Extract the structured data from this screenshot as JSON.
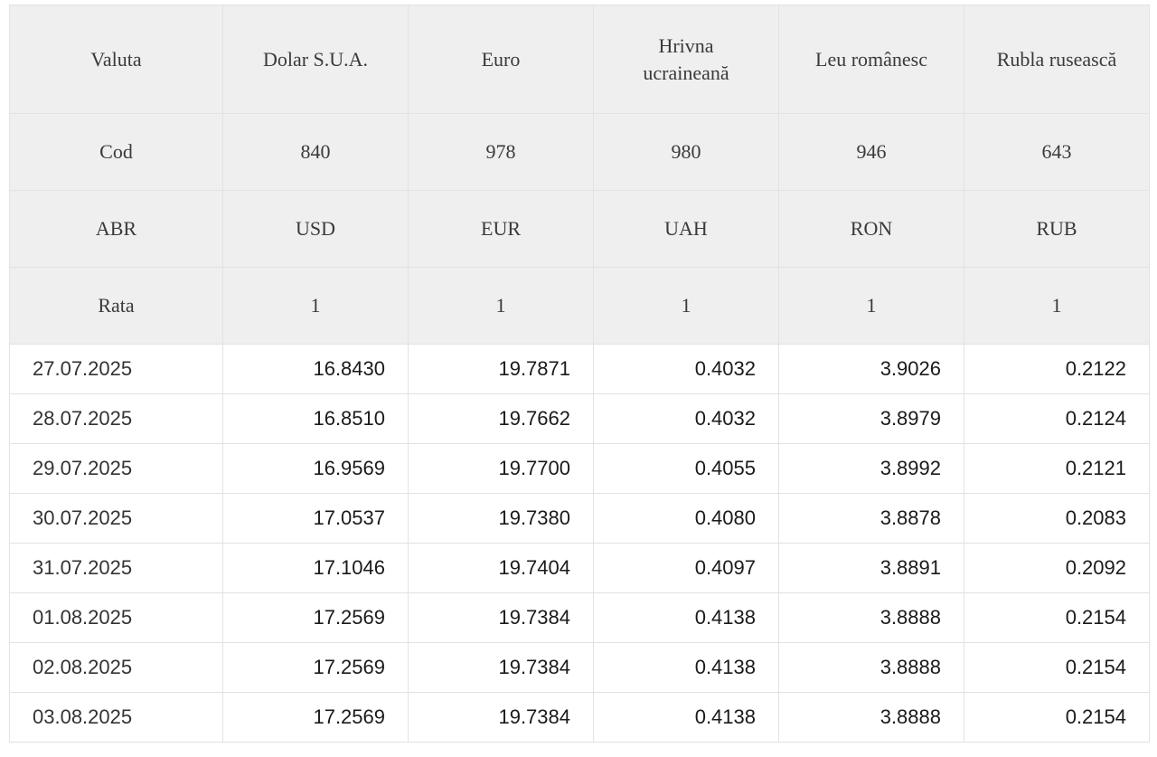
{
  "header": {
    "label_valuta": "Valuta",
    "label_cod": "Cod",
    "label_abr": "ABR",
    "label_rata": "Rata",
    "currencies": [
      {
        "name": "Dolar S.U.A.",
        "code": "840",
        "abr": "USD",
        "rate": "1"
      },
      {
        "name": "Euro",
        "code": "978",
        "abr": "EUR",
        "rate": "1"
      },
      {
        "name": "Hrivna ucraineană",
        "code": "980",
        "abr": "UAH",
        "rate": "1"
      },
      {
        "name": "Leu românesc",
        "code": "946",
        "abr": "RON",
        "rate": "1"
      },
      {
        "name": "Rubla rusească",
        "code": "643",
        "abr": "RUB",
        "rate": "1"
      }
    ]
  },
  "rows": [
    {
      "date": "27.07.2025",
      "values": [
        "16.8430",
        "19.7871",
        "0.4032",
        "3.9026",
        "0.2122"
      ]
    },
    {
      "date": "28.07.2025",
      "values": [
        "16.8510",
        "19.7662",
        "0.4032",
        "3.8979",
        "0.2124"
      ]
    },
    {
      "date": "29.07.2025",
      "values": [
        "16.9569",
        "19.7700",
        "0.4055",
        "3.8992",
        "0.2121"
      ]
    },
    {
      "date": "30.07.2025",
      "values": [
        "17.0537",
        "19.7380",
        "0.4080",
        "3.8878",
        "0.2083"
      ]
    },
    {
      "date": "31.07.2025",
      "values": [
        "17.1046",
        "19.7404",
        "0.4097",
        "3.8891",
        "0.2092"
      ]
    },
    {
      "date": "01.08.2025",
      "values": [
        "17.2569",
        "19.7384",
        "0.4138",
        "3.8888",
        "0.2154"
      ]
    },
    {
      "date": "02.08.2025",
      "values": [
        "17.2569",
        "19.7384",
        "0.4138",
        "3.8888",
        "0.2154"
      ]
    },
    {
      "date": "03.08.2025",
      "values": [
        "17.2569",
        "19.7384",
        "0.4138",
        "3.8888",
        "0.2154"
      ]
    }
  ]
}
